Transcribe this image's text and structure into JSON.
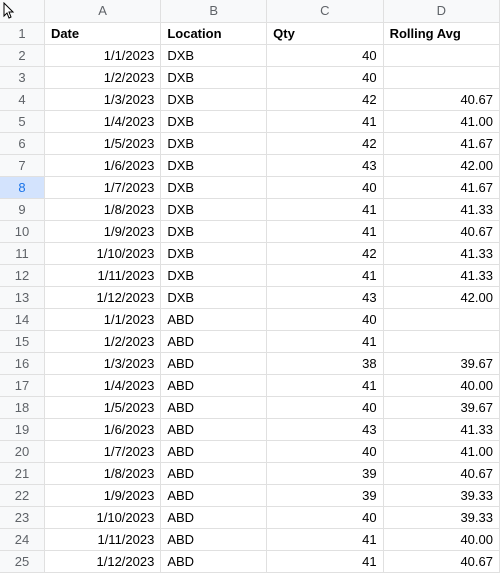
{
  "columns": [
    "A",
    "B",
    "C",
    "D"
  ],
  "selectedRow": 8,
  "headers": {
    "A": "Date",
    "B": "Location",
    "C": "Qty",
    "D": "Rolling Avg"
  },
  "rows": [
    {
      "n": 2,
      "A": "1/1/2023",
      "B": "DXB",
      "C": "40",
      "D": ""
    },
    {
      "n": 3,
      "A": "1/2/2023",
      "B": "DXB",
      "C": "40",
      "D": ""
    },
    {
      "n": 4,
      "A": "1/3/2023",
      "B": "DXB",
      "C": "42",
      "D": "40.67"
    },
    {
      "n": 5,
      "A": "1/4/2023",
      "B": "DXB",
      "C": "41",
      "D": "41.00"
    },
    {
      "n": 6,
      "A": "1/5/2023",
      "B": "DXB",
      "C": "42",
      "D": "41.67"
    },
    {
      "n": 7,
      "A": "1/6/2023",
      "B": "DXB",
      "C": "43",
      "D": "42.00"
    },
    {
      "n": 8,
      "A": "1/7/2023",
      "B": "DXB",
      "C": "40",
      "D": "41.67"
    },
    {
      "n": 9,
      "A": "1/8/2023",
      "B": "DXB",
      "C": "41",
      "D": "41.33"
    },
    {
      "n": 10,
      "A": "1/9/2023",
      "B": "DXB",
      "C": "41",
      "D": "40.67"
    },
    {
      "n": 11,
      "A": "1/10/2023",
      "B": "DXB",
      "C": "42",
      "D": "41.33"
    },
    {
      "n": 12,
      "A": "1/11/2023",
      "B": "DXB",
      "C": "41",
      "D": "41.33"
    },
    {
      "n": 13,
      "A": "1/12/2023",
      "B": "DXB",
      "C": "43",
      "D": "42.00"
    },
    {
      "n": 14,
      "A": "1/1/2023",
      "B": "ABD",
      "C": "40",
      "D": ""
    },
    {
      "n": 15,
      "A": "1/2/2023",
      "B": "ABD",
      "C": "41",
      "D": ""
    },
    {
      "n": 16,
      "A": "1/3/2023",
      "B": "ABD",
      "C": "38",
      "D": "39.67"
    },
    {
      "n": 17,
      "A": "1/4/2023",
      "B": "ABD",
      "C": "41",
      "D": "40.00"
    },
    {
      "n": 18,
      "A": "1/5/2023",
      "B": "ABD",
      "C": "40",
      "D": "39.67"
    },
    {
      "n": 19,
      "A": "1/6/2023",
      "B": "ABD",
      "C": "43",
      "D": "41.33"
    },
    {
      "n": 20,
      "A": "1/7/2023",
      "B": "ABD",
      "C": "40",
      "D": "41.00"
    },
    {
      "n": 21,
      "A": "1/8/2023",
      "B": "ABD",
      "C": "39",
      "D": "40.67"
    },
    {
      "n": 22,
      "A": "1/9/2023",
      "B": "ABD",
      "C": "39",
      "D": "39.33"
    },
    {
      "n": 23,
      "A": "1/10/2023",
      "B": "ABD",
      "C": "40",
      "D": "39.33"
    },
    {
      "n": 24,
      "A": "1/11/2023",
      "B": "ABD",
      "C": "41",
      "D": "40.00"
    },
    {
      "n": 25,
      "A": "1/12/2023",
      "B": "ABD",
      "C": "41",
      "D": "40.67"
    }
  ]
}
